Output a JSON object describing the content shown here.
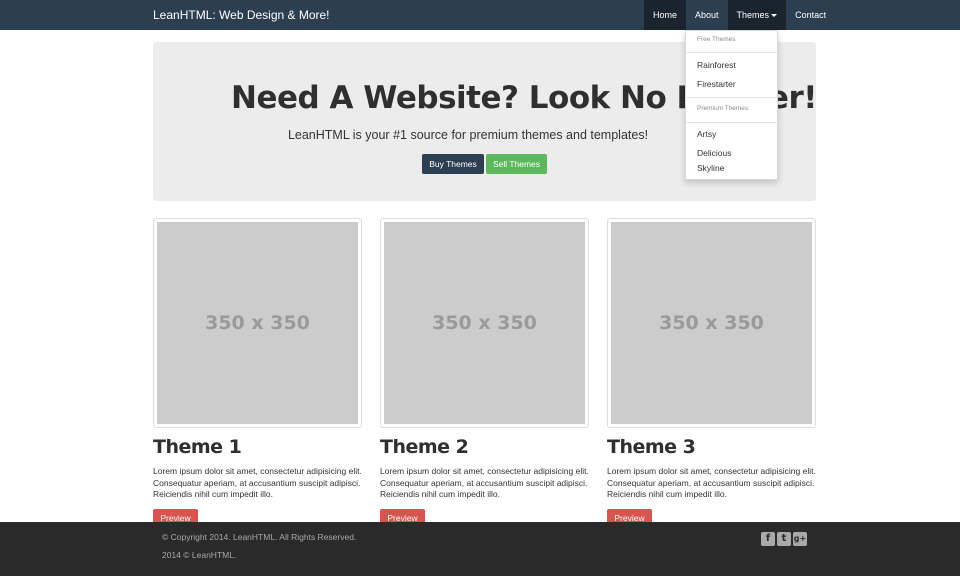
{
  "navbar": {
    "brand": "LeanHTML: Web Design & More!",
    "items": [
      {
        "label": "Home"
      },
      {
        "label": "About"
      },
      {
        "label": "Themes"
      },
      {
        "label": "Contact"
      }
    ]
  },
  "dropdown": {
    "free_header": "Free Themes",
    "free_items": [
      "Rainforest",
      "Firestarter"
    ],
    "premium_header": "Premium Themes",
    "premium_items": [
      "Artsy",
      "Delicious",
      "Skyline"
    ]
  },
  "jumbotron": {
    "title": "Need A Website? Look No Further!",
    "subtitle": "LeanHTML is your #1 source for premium themes and templates!",
    "buy_label": "Buy Themes",
    "sell_label": "Sell Themes"
  },
  "themes": [
    {
      "image_label": "350 x 350",
      "title": "Theme 1",
      "text_lines": [
        "Lorem ipsum dolor sit amet, consectetur adipisicing elit.",
        "Consequatur aperiam, at accusantium suscipit adipisci.",
        "Reiciendis nihil cum impedit illo."
      ],
      "button": "Preview"
    },
    {
      "image_label": "350 x 350",
      "title": "Theme 2",
      "text_lines": [
        "Lorem ipsum dolor sit amet, consectetur adipisicing elit.",
        "Consequatur aperiam, at accusantium suscipit adipisci.",
        "Reiciendis nihil cum impedit illo."
      ],
      "button": "Preview"
    },
    {
      "image_label": "350 x 350",
      "title": "Theme 3",
      "text_lines": [
        "Lorem ipsum dolor sit amet, consectetur adipisicing elit.",
        "Consequatur aperiam, at accusantium suscipit adipisci.",
        "Reiciendis nihil cum impedit illo."
      ],
      "button": "Preview"
    }
  ],
  "footer": {
    "copyright": "© Copyright 2014. LeanHTML. All Rights Reserved.",
    "small": "2014 © LeanHTML.",
    "social_icons": [
      "facebook-icon",
      "twitter-icon",
      "google-plus-icon"
    ]
  },
  "colors": {
    "navbar": "#2c3e50",
    "buy_button": "#2c3e50",
    "sell_button": "#5cb85c",
    "preview_button": "#d9534f",
    "footer": "#2a2a2a"
  }
}
